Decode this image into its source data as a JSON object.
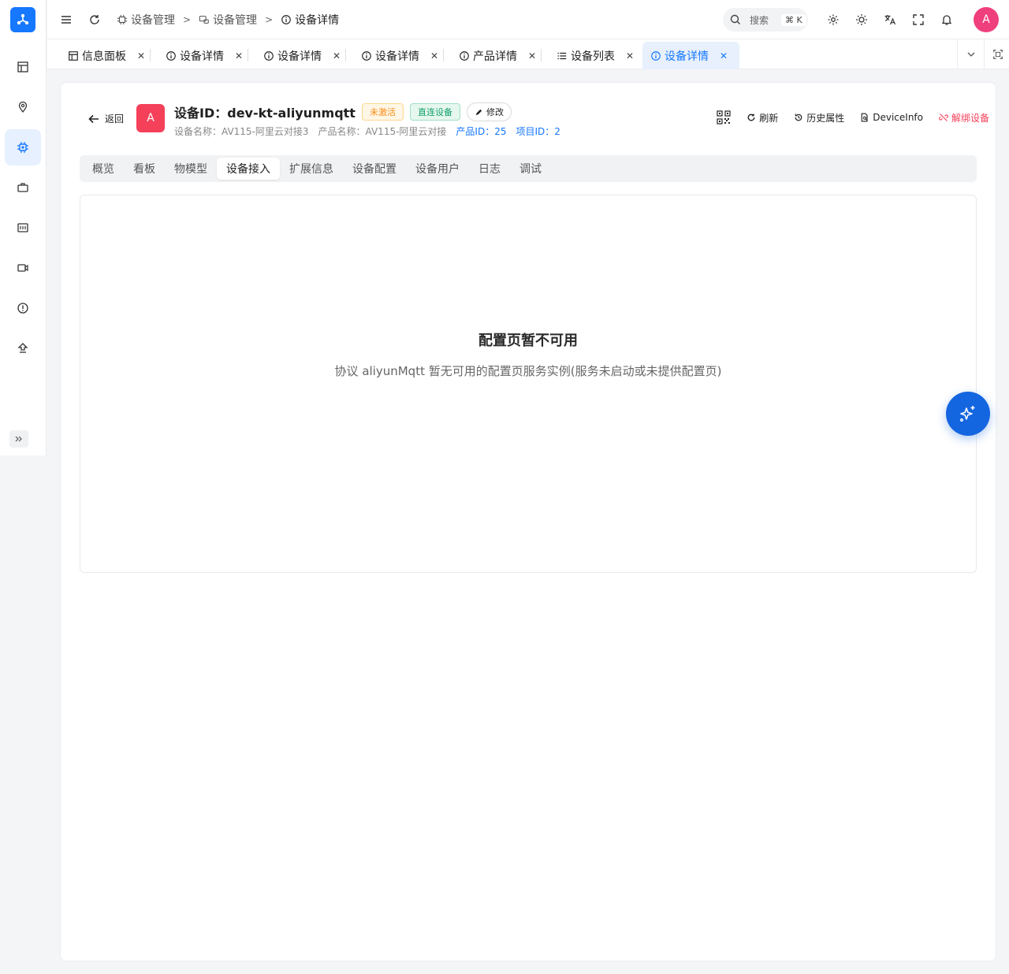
{
  "sidebar": {
    "logo_icon": "app-logo-icon",
    "items": [
      {
        "icon": "dashboard-icon"
      },
      {
        "icon": "map-pin-icon"
      },
      {
        "icon": "chip-icon",
        "active": true
      },
      {
        "icon": "briefcase-icon"
      },
      {
        "icon": "monitor-icon"
      },
      {
        "icon": "video-camera-icon"
      },
      {
        "icon": "alert-circle-icon"
      },
      {
        "icon": "upgrade-icon"
      }
    ],
    "expand_icon": "double-chevron-right-icon"
  },
  "header": {
    "breadcrumbs": [
      "设备管理",
      "设备管理",
      "设备详情"
    ],
    "search": {
      "label": "搜索",
      "shortcut": "⌘ K"
    },
    "avatar_letter": "A"
  },
  "tabs": [
    {
      "label": "信息面板",
      "icon": "dashboard-icon"
    },
    {
      "label": "设备详情",
      "icon": "info-icon"
    },
    {
      "label": "设备详情",
      "icon": "info-icon"
    },
    {
      "label": "设备详情",
      "icon": "info-icon"
    },
    {
      "label": "产品详情",
      "icon": "info-icon"
    },
    {
      "label": "设备列表",
      "icon": "list-icon"
    },
    {
      "label": "设备详情",
      "icon": "info-icon",
      "active": true
    }
  ],
  "device": {
    "back_label": "返回",
    "avatar_letter": "A",
    "title": "设备ID：dev-kt-aliyunmqtt",
    "status_badge": "未激活",
    "type_badge": "直连设备",
    "edit_label": "修改",
    "name_meta": "设备名称：AV115-阿里云对接3",
    "product_meta": "产品名称：AV115-阿里云对接",
    "product_id": "产品ID：25",
    "project_id": "项目ID：2",
    "actions": {
      "refresh": "刷新",
      "history": "历史属性",
      "device_info": "DeviceInfo",
      "unbind": "解绑设备"
    }
  },
  "detail_tabs": [
    "概览",
    "看板",
    "物模型",
    "设备接入",
    "扩展信息",
    "设备配置",
    "设备用户",
    "日志",
    "调试"
  ],
  "active_detail_tab": "设备接入",
  "panel": {
    "title": "配置页暂不可用",
    "description": "协议 aliyunMqtt 暂无可用的配置页服务实例(服务未启动或未提供配置页)"
  },
  "colors": {
    "accent": "#1677ff",
    "danger": "#f5405a",
    "avatar": "#ef3f7c",
    "fab": "#1465e0"
  }
}
